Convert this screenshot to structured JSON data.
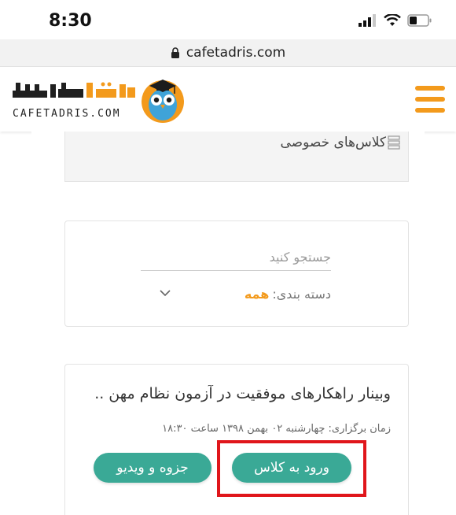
{
  "status_bar": {
    "time": "8:30"
  },
  "browser": {
    "url": "cafetadris.com"
  },
  "header": {
    "logo_text": "CAFETADRIS.COM",
    "logo_persian": "کافه تدریس"
  },
  "widget": {
    "private_classes": "کلاس‌های خصوصی"
  },
  "search": {
    "placeholder": "جستجو کنید",
    "category_label": "دسته بندی:",
    "category_value": "همه"
  },
  "course": {
    "title": "وبینار راهکارهای موفقیت در آزمون نظام مهن ..",
    "time_text": "زمان برگزاری: چهارشنبه ۰۲ بهمن ۱۳۹۸ ساعت ۱۸:۳۰",
    "enter_button": "ورود به کلاس",
    "pamphlet_button": "جزوه و ویدیو"
  },
  "colors": {
    "accent_orange": "#f39a1c",
    "button_teal": "#3aa996",
    "highlight_red": "#e0161b"
  }
}
